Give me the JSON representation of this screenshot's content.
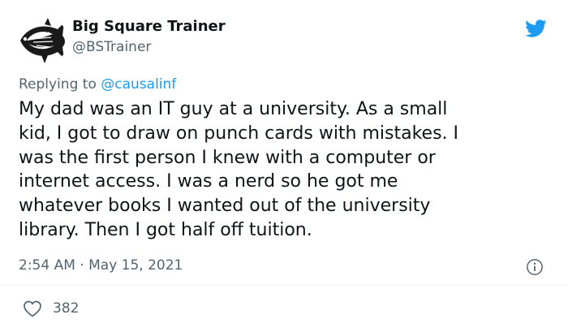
{
  "author": {
    "name": "Big Square Trainer",
    "handle": "@BSTrainer",
    "avatar_icon": "fish-logo-icon"
  },
  "reply": {
    "prefix": "Replying to",
    "mention": "@causalinf"
  },
  "tweet": {
    "text": "My dad was an IT guy at a university. As a small\nkid, I got to draw on punch cards with mistakes. I\nwas the first person I knew with a computer or\ninternet access. I was a nerd so he got me\nwhatever books I wanted out of the university\nlibrary. Then I got half off tuition.",
    "time": "2:54 AM",
    "separator": "·",
    "date": "May 15, 2021"
  },
  "stats": {
    "likes": "382"
  },
  "icons": {
    "brand": "twitter-bird-icon",
    "info": "info-icon",
    "like": "heart-icon"
  },
  "colors": {
    "accent": "#1d9bf0",
    "secondary_text": "#536471",
    "primary_text": "#0f1419"
  }
}
